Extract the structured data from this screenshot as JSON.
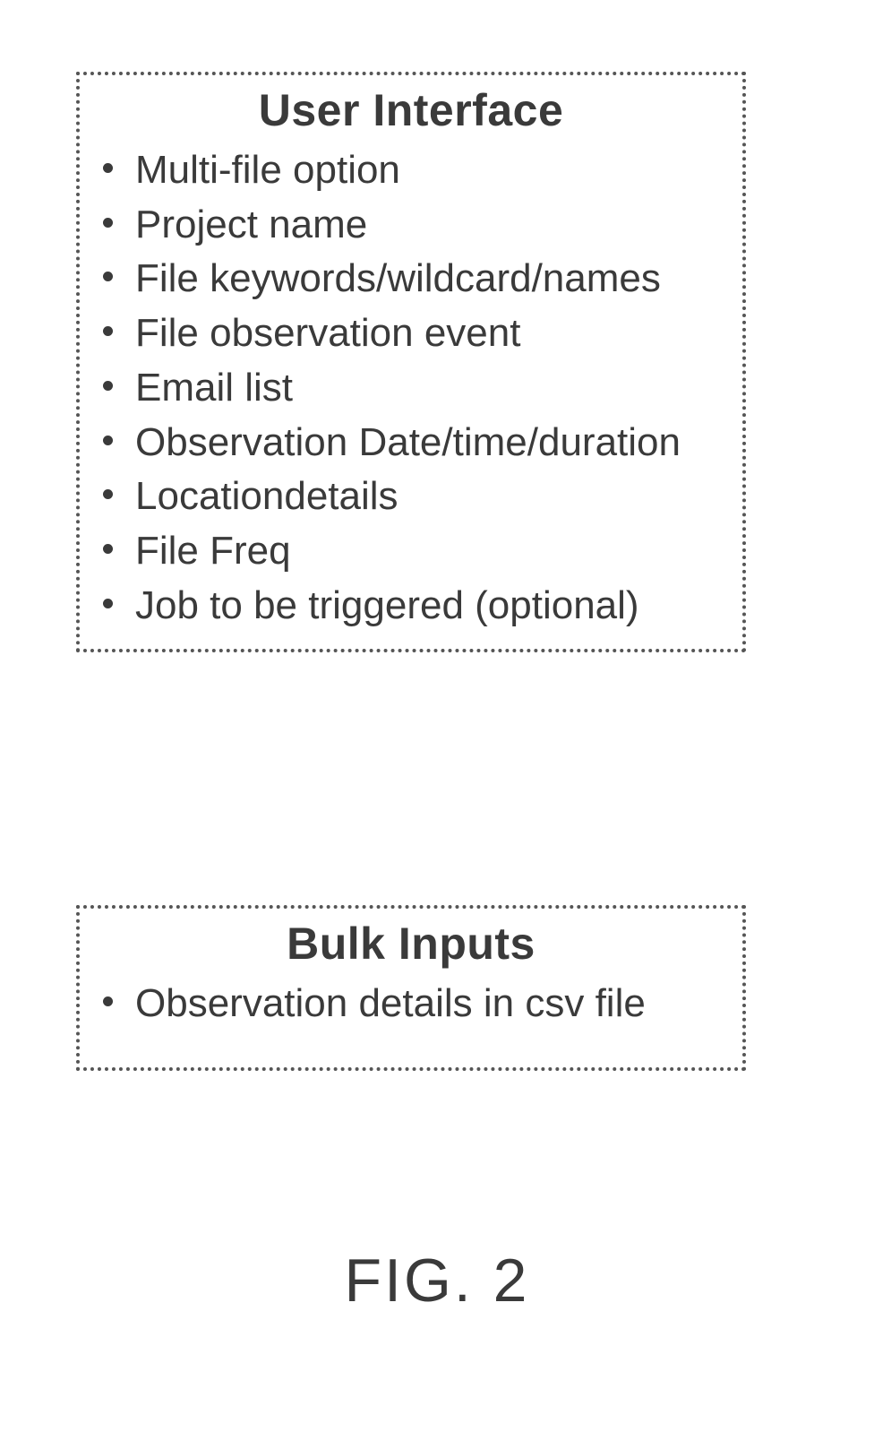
{
  "box1": {
    "title": "User Interface",
    "items": [
      "Multi-file option",
      "Project name",
      "File keywords/wildcard/names",
      "File observation event",
      "Email list",
      "Observation Date/time/duration",
      "Locationdetails",
      "File Freq",
      "Job to be triggered (optional)"
    ]
  },
  "box2": {
    "title": "Bulk Inputs",
    "items": [
      "Observation details in csv file"
    ]
  },
  "figure_label": "FIG. 2"
}
